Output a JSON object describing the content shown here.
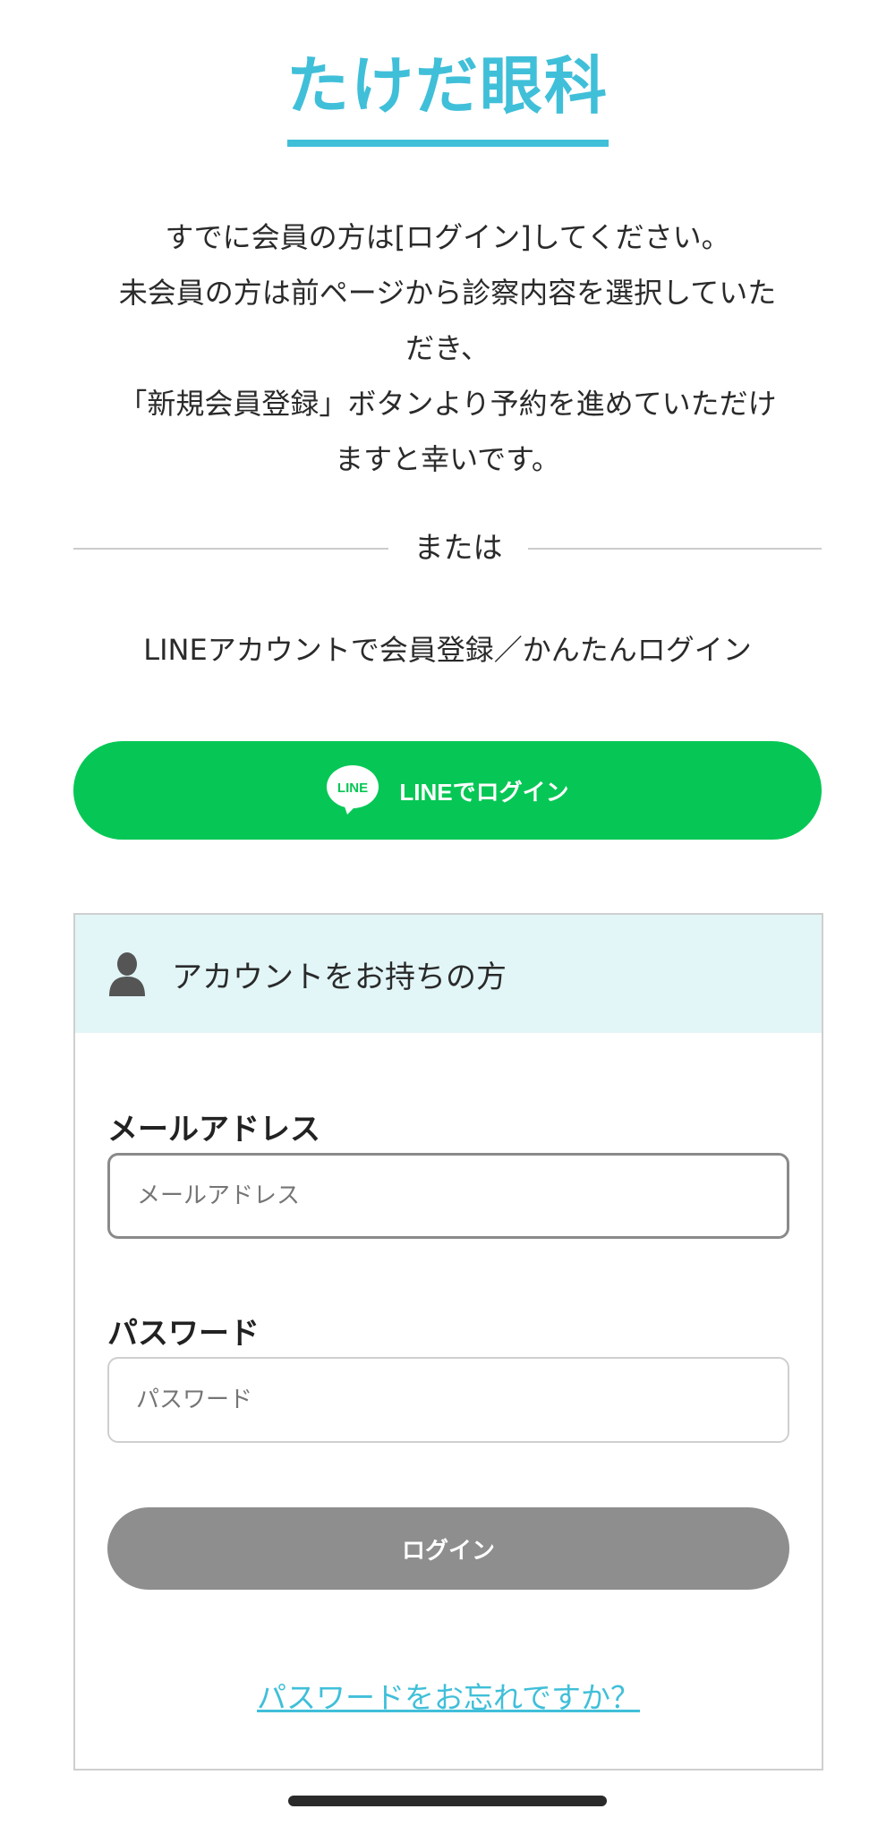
{
  "header": {
    "title": "たけだ眼科"
  },
  "intro": {
    "lines": [
      "すでに会員の方は[ログイン]してください。",
      "未会員の方は前ページから診察内容を選択していた",
      "だき、",
      "「新規会員登録」ボタンより予約を進めていただけ",
      "ますと幸いです。"
    ]
  },
  "divider": {
    "label": "または"
  },
  "line_login": {
    "caption": "LINEアカウントで会員登録／かんたんログイン",
    "logo_text": "LINE",
    "button_label": "LINEでログイン",
    "button_color": "#06C755"
  },
  "login_card": {
    "header_icon": "person-icon",
    "header_title": "アカウントをお持ちの方",
    "email": {
      "label": "メールアドレス",
      "placeholder": "メールアドレス",
      "value": ""
    },
    "password": {
      "label": "パスワード",
      "placeholder": "パスワード",
      "value": ""
    },
    "submit_label": "ログイン",
    "forgot_label": "パスワードをお忘れですか？"
  },
  "colors": {
    "accent": "#40BFD9",
    "card_header_bg": "#E2F5F7",
    "submit_disabled": "#8E8E8E"
  }
}
